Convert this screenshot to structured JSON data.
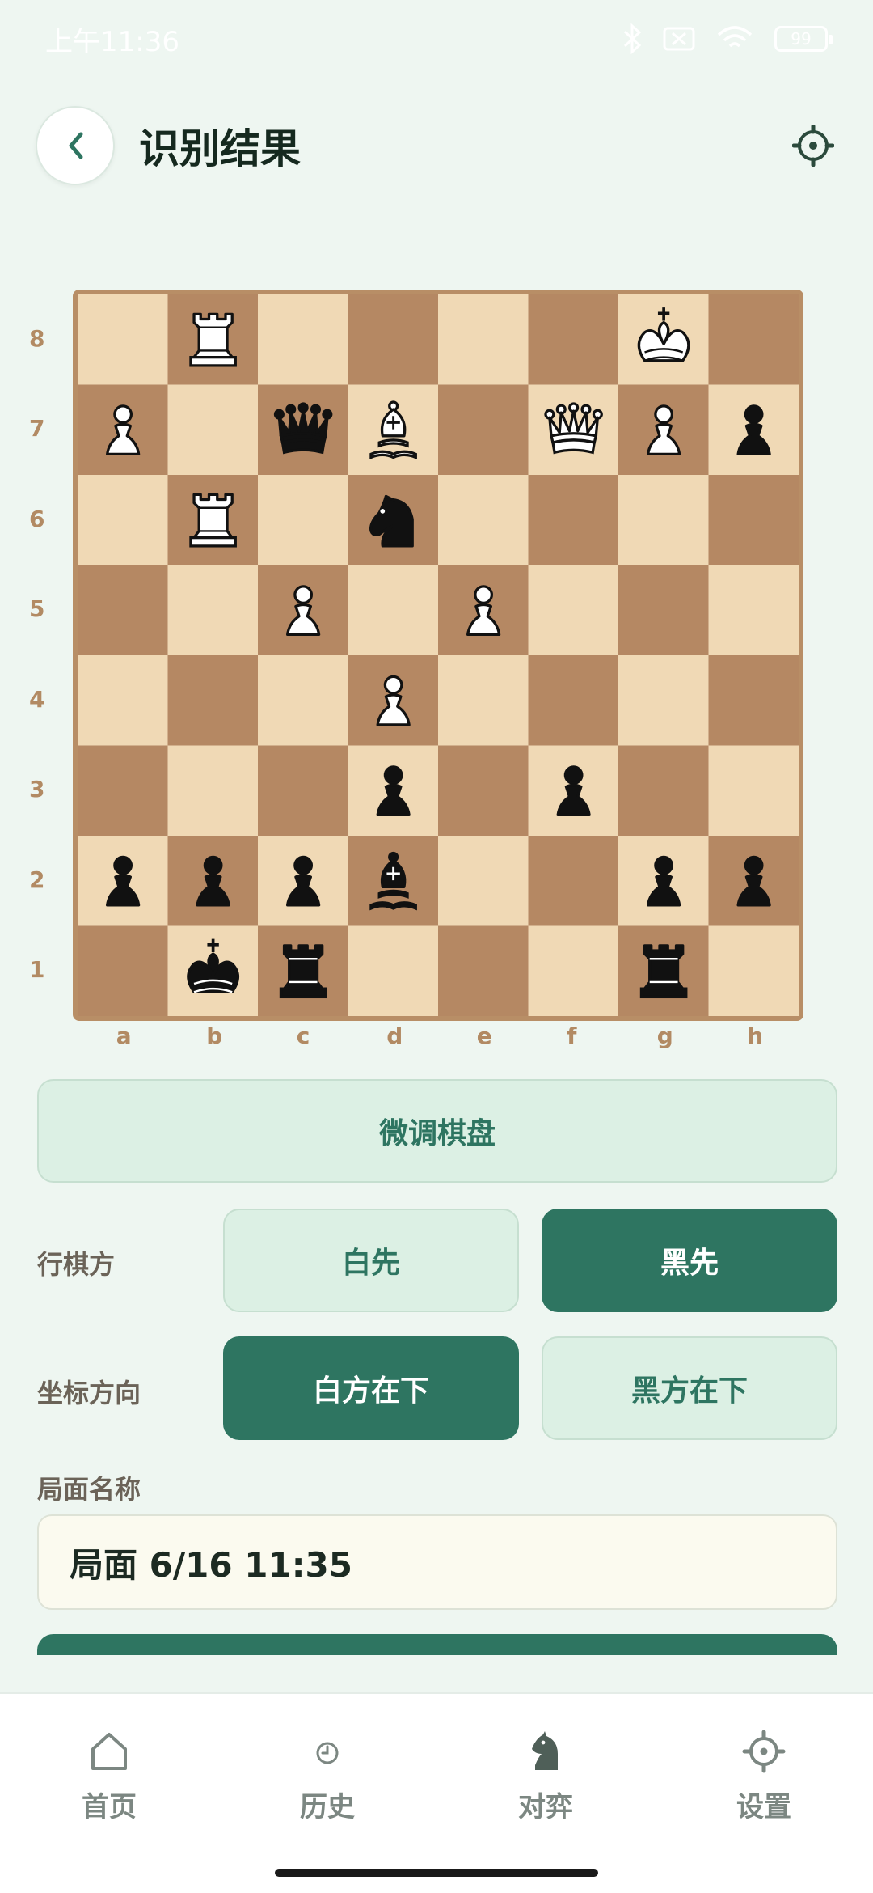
{
  "status_bar": {
    "time": "上午11:36",
    "battery": "99"
  },
  "header": {
    "title": "识别结果"
  },
  "board": {
    "ranks": [
      "8",
      "7",
      "6",
      "5",
      "4",
      "3",
      "2",
      "1"
    ],
    "files": [
      "a",
      "b",
      "c",
      "d",
      "e",
      "f",
      "g",
      "h"
    ],
    "rows": [
      [
        "",
        "wR",
        "",
        "",
        "",
        "",
        "wK",
        ""
      ],
      [
        "wP",
        "",
        "bQ",
        "wB",
        "",
        "wQ",
        "wP",
        "bP"
      ],
      [
        "",
        "wR",
        "",
        "bN",
        "",
        "",
        "",
        ""
      ],
      [
        "",
        "",
        "wP",
        "",
        "wP",
        "",
        "",
        ""
      ],
      [
        "",
        "",
        "",
        "wP",
        "",
        "",
        "",
        ""
      ],
      [
        "",
        "",
        "",
        "bP",
        "",
        "bP",
        "",
        ""
      ],
      [
        "bP",
        "bP",
        "bP",
        "bB",
        "",
        "",
        "bP",
        "bP"
      ],
      [
        "",
        "bK",
        "bR",
        "",
        "",
        "",
        "bR",
        ""
      ]
    ],
    "colors": {
      "light": "#f0d9b5",
      "dark": "#b58863"
    }
  },
  "adjust_button": "微调棋盘",
  "turn": {
    "label": "行棋方",
    "white": "白先",
    "black": "黑先",
    "selected": "black"
  },
  "orientation": {
    "label": "坐标方向",
    "white_bottom": "白方在下",
    "black_bottom": "黑方在下",
    "selected": "white_bottom"
  },
  "position_name": {
    "label": "局面名称",
    "value": "局面 6/16 11:35"
  },
  "nav": {
    "items": [
      {
        "label": "首页",
        "icon": "home-icon"
      },
      {
        "label": "历史",
        "icon": "history-icon"
      },
      {
        "label": "对弈",
        "icon": "knight-icon"
      },
      {
        "label": "设置",
        "icon": "gear-icon"
      }
    ]
  },
  "accent": "#2e7561"
}
